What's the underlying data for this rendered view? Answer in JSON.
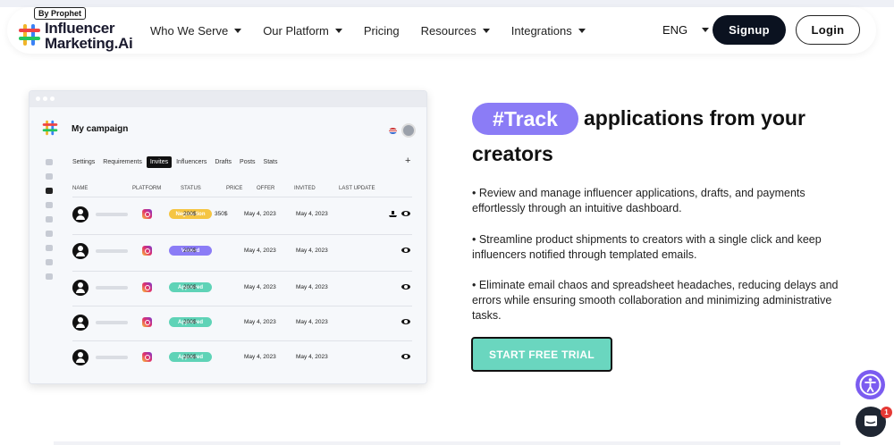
{
  "nav": {
    "logo_badge": "By Prophet",
    "logo_line1": "Influencer",
    "logo_line2": "Marketing.Ai",
    "links": [
      "Who We Serve",
      "Our Platform",
      "Pricing",
      "Resources",
      "Integrations"
    ],
    "links_dropdown": [
      true,
      true,
      false,
      true,
      true
    ],
    "language": "ENG",
    "signup_label": "Signup",
    "login_label": "Login"
  },
  "mockup": {
    "title": "My campaign",
    "tabs": [
      "Settings",
      "Requirements",
      "Invites",
      "Influencers",
      "Drafts",
      "Posts",
      "Stats"
    ],
    "active_tab": "Invites",
    "add_label": "+",
    "columns": [
      "NAME",
      "PLATFORM",
      "STATUS",
      "PRICE",
      "OFFER",
      "INVITED",
      "LAST UPDATE"
    ],
    "rows": [
      {
        "platform": "instagram",
        "status": "Negotiation",
        "status_color": "#f5c542",
        "price": "200$",
        "offer": "350$",
        "invited": "May 4, 2023",
        "last_update": "May 4, 2023",
        "has_ship": true
      },
      {
        "platform": "instagram",
        "status": "Viewed",
        "status_color": "#8b7cf6",
        "price": "200$",
        "offer": "",
        "invited": "May 4, 2023",
        "last_update": "May 4, 2023",
        "has_ship": false
      },
      {
        "platform": "instagram",
        "status": "Approved",
        "status_color": "#5fd3b7",
        "price": "200$",
        "offer": "",
        "invited": "May 4, 2023",
        "last_update": "May 4, 2023",
        "has_ship": false
      },
      {
        "platform": "instagram",
        "status": "Approved",
        "status_color": "#5fd3b7",
        "price": "200$",
        "offer": "",
        "invited": "May 4, 2023",
        "last_update": "May 4, 2023",
        "has_ship": false
      },
      {
        "platform": "instagram",
        "status": "Approved",
        "status_color": "#5fd3b7",
        "price": "200$",
        "offer": "",
        "invited": "May 4, 2023",
        "last_update": "May 4, 2023",
        "has_ship": false
      }
    ]
  },
  "hero": {
    "pill": "#Track",
    "headline_rest": "applications from your",
    "headline_line2": "creators",
    "bullets": [
      "• Review and manage influencer applications, drafts, and payments effortlessly through an intuitive dashboard.",
      "• Streamline product shipments to creators with a single click and keep influencers notified through templated emails.",
      "• Eliminate email chaos and spreadsheet headaches, reducing delays and errors while ensuring smooth collaboration and minimizing administrative tasks."
    ],
    "cta_label": "START FREE TRIAL"
  },
  "widgets": {
    "chat_badge_count": "1",
    "accent_purple": "#8b7cf6",
    "accent_teal": "#6ad6bf"
  }
}
